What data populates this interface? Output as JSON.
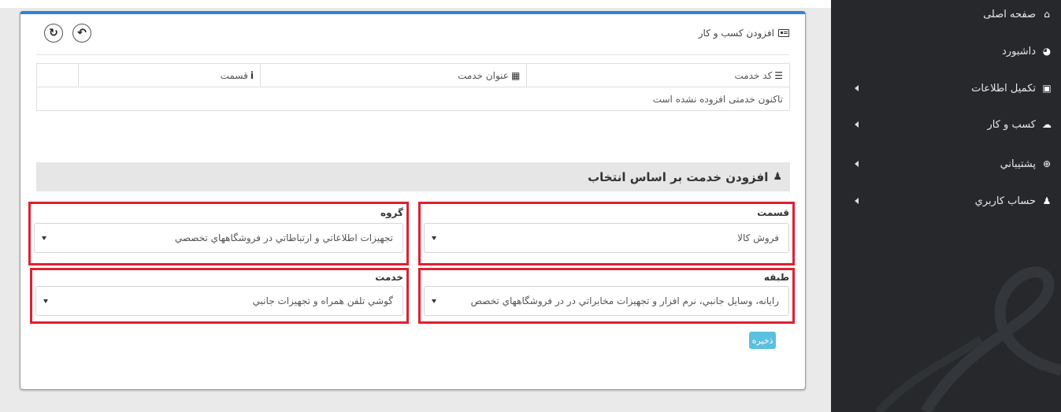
{
  "sidebar": {
    "items": [
      {
        "label": "صفحه اصلی",
        "icon": "home-icon",
        "glyph": "⌂",
        "has_arrow": false
      },
      {
        "label": "داشبورد",
        "icon": "dashboard-icon",
        "glyph": "◕",
        "has_arrow": false
      },
      {
        "label": "تکمیل اطلاعات",
        "icon": "id-card-icon",
        "glyph": "▣",
        "has_arrow": true
      },
      {
        "label": "کسب و کار",
        "icon": "cloud-icon",
        "glyph": "☁",
        "has_arrow": true
      },
      {
        "label": "پشتيباني",
        "icon": "lifebuoy-icon",
        "glyph": "⊕",
        "has_arrow": true
      },
      {
        "label": "حساب کاربري",
        "icon": "user-icon",
        "glyph": "♟",
        "has_arrow": true
      }
    ]
  },
  "panel": {
    "title": "افزودن کسب و کار",
    "refresh_glyph": "↻",
    "back_glyph": "↶"
  },
  "table": {
    "headers": {
      "code": "کد خدمت",
      "title": "عنوان خدمت",
      "section": "قسمت"
    },
    "empty_message": "تاکنون خدمتی افزوده نشده است"
  },
  "form": {
    "section_title": "افزودن خدمت بر اساس انتخاب",
    "qesmat": {
      "label": "قسمت",
      "value": "فروش کالا"
    },
    "goroh": {
      "label": "گروه",
      "value": "تجهيزات اطلاعاتي و ارتباطاتي در فروشگاههاي تخصصي"
    },
    "tabaqe": {
      "label": "طبقه",
      "value": "رايانه، وسايل جانبي، نرم افزار و تجهيزات مخابراتي در در فروشگاههاي تخصص"
    },
    "khedmat": {
      "label": "خدمت",
      "value": "گوشي تلفن همراه و تجهيزات جانبي"
    },
    "save_label": "ذخیره"
  },
  "colors": {
    "accent": "#2f84d6",
    "highlight": "#e02030",
    "save": "#5bc0de",
    "sidebar": "#26282b"
  }
}
